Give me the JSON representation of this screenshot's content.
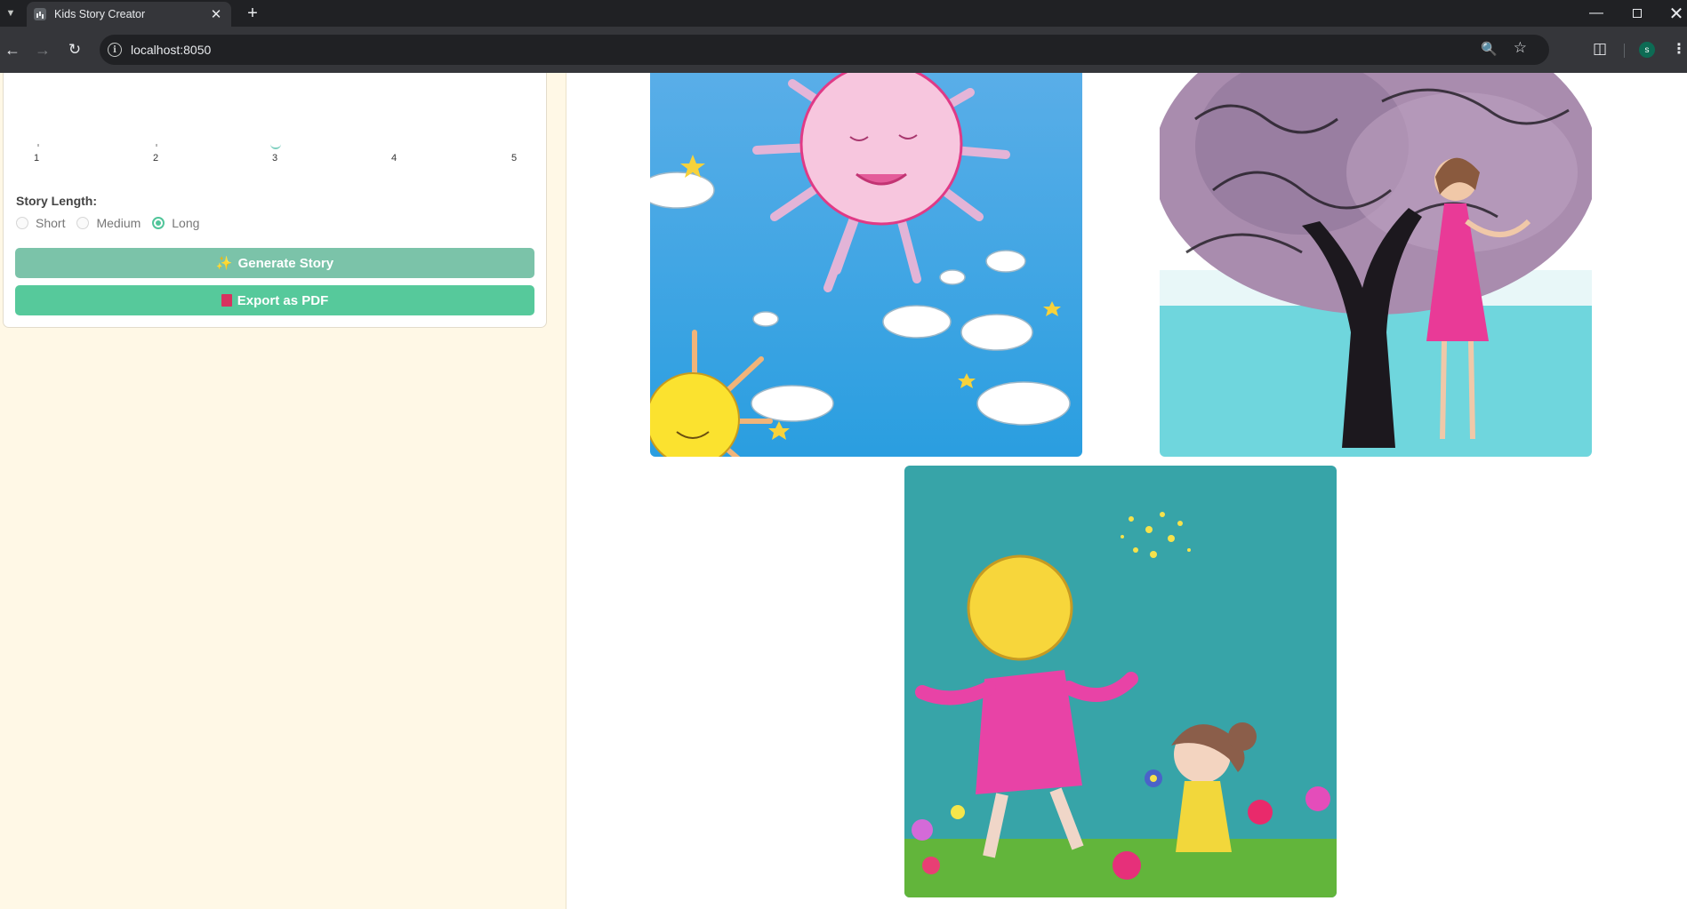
{
  "browser": {
    "tab_title": "Kids Story Creator",
    "url": "localhost:8050",
    "profile_initial": "s"
  },
  "sidebar": {
    "slider_marks": [
      "1",
      "2",
      "3",
      "4",
      "5"
    ],
    "story_length_label": "Story Length:",
    "length_options": [
      {
        "label": "Short",
        "checked": false
      },
      {
        "label": "Medium",
        "checked": false
      },
      {
        "label": "Long",
        "checked": true
      }
    ],
    "generate_button": "Generate Story",
    "export_button": "Export as PDF"
  },
  "colors": {
    "accent_green": "#56c99b",
    "sidebar_bg": "#fff8e6"
  },
  "illustrations": [
    {
      "subject": "sun-and-clouds"
    },
    {
      "subject": "girl-under-tree"
    },
    {
      "subject": "children-in-flower-field"
    }
  ]
}
